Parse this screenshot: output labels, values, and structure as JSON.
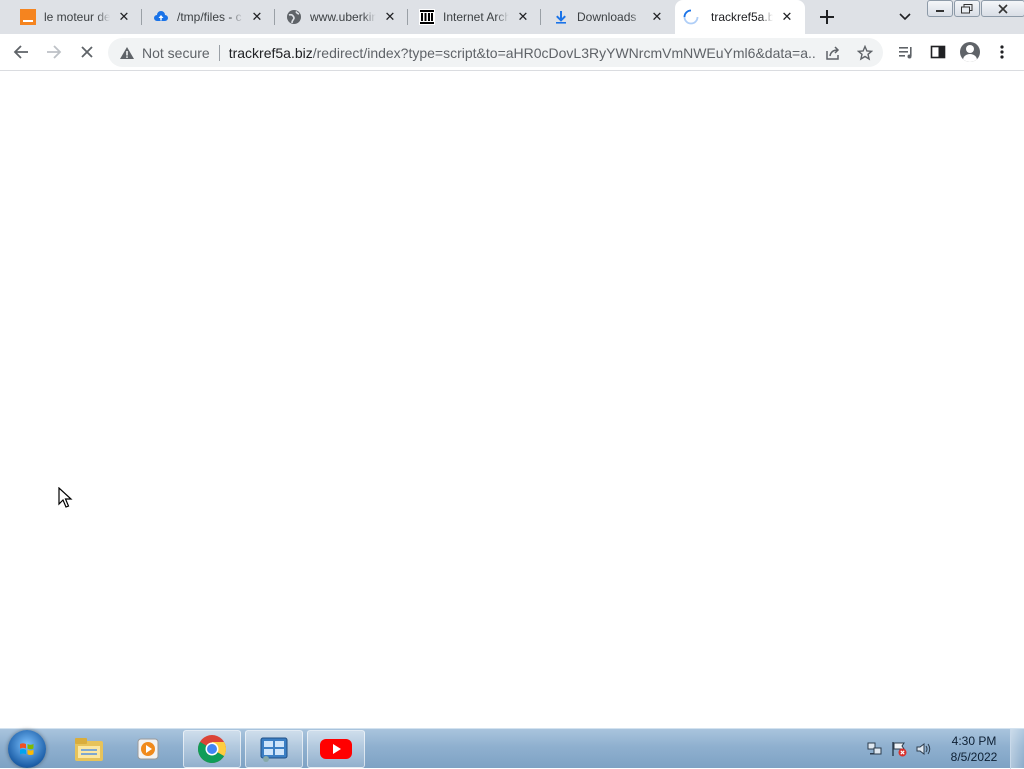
{
  "browser": {
    "tabs": [
      {
        "title": "le moteur de",
        "favicon": "orange-square-icon",
        "active": false
      },
      {
        "title": "/tmp/files - c",
        "favicon": "cloud-upload-icon",
        "active": false
      },
      {
        "title": "www.uberkin",
        "favicon": "globe-icon",
        "active": false
      },
      {
        "title": "Internet Arch",
        "favicon": "internet-archive-icon",
        "active": false
      },
      {
        "title": "Downloads",
        "favicon": "download-icon",
        "active": false
      },
      {
        "title": "trackref5a.biz",
        "favicon": "loading-spinner-icon",
        "active": true
      }
    ],
    "omnibox": {
      "security_label": "Not secure",
      "url_host": "trackref5a.biz",
      "url_rest": "/redirect/index?type=script&to=aHR0cDovL3RyYWNrcmVmNWEuYml6&data=a..."
    }
  },
  "taskbar": {
    "apps": [
      "windows-explorer-icon",
      "media-player-icon",
      "chrome-icon",
      "control-panel-icon",
      "youtube-icon"
    ],
    "clock": {
      "time": "4:30 PM",
      "date": "8/5/2022"
    }
  },
  "colors": {
    "tabstrip_bg": "#dee1e6",
    "omnibox_bg": "#f1f3f4",
    "taskbar_bg": "#8fb0cf"
  }
}
